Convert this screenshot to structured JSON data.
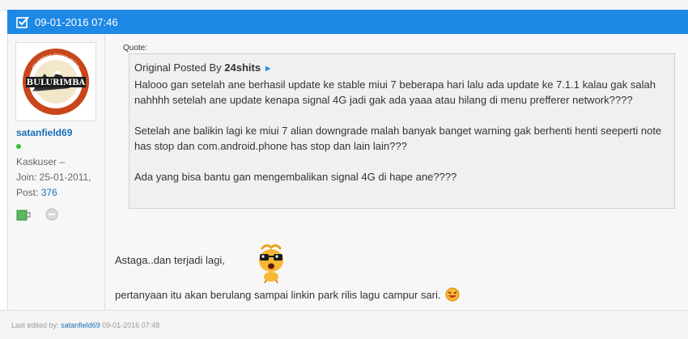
{
  "post": {
    "timestamp": "09-01-2016 07:46"
  },
  "user": {
    "username": "satanfield69",
    "rank": "Kaskuser –",
    "join_label": "Join: 25-01-2011,",
    "post_label": "Post:",
    "post_count": "376",
    "avatar_text": "BULURIMBA",
    "avatar_top_text": "KELOMPOK TEKNIK MESIN",
    "avatar_bottom_text": "SUKA DAMAI INDAH MESIN BIAS AJA"
  },
  "quote": {
    "label": "Quote:",
    "original_prefix": "Original Posted By",
    "original_poster": "24shits",
    "arrow": "►",
    "paragraphs": [
      "Halooo gan setelah ane berhasil update ke stable miui 7 beberapa hari lalu ada update ke 7.1.1 kalau gak salah nahhhh setelah ane update kenapa signal 4G jadi gak ada yaaa atau hilang di menu prefferer network????",
      "Setelah ane balikin lagi ke miui 7 alian downgrade malah banyak banget warning gak berhenti henti seeperti note has stop dan com.android.phone has stop dan lain lain???",
      "Ada yang bisa bantu gan mengembalikan signal 4G di hape ane????"
    ]
  },
  "message": {
    "line1": "Astaga..dan terjadi lagi,",
    "line2": "pertanyaan itu akan berulang sampai linkin park rilis lagu campur sari."
  },
  "footer": {
    "edited_prefix": "Last edited by:",
    "edited_user": "satanfield69",
    "edited_time": "09-01-2016 07:48"
  },
  "icons": {
    "header": "checkbox-icon",
    "user_icon_1": "reputation-icon",
    "user_icon_2": "offline-icon",
    "emoticon_big": "shocked-emoticon",
    "emoticon_small": "laughing-emoticon"
  },
  "colors": {
    "header_bg": "#1e88e5",
    "username": "#1a6fb5",
    "online": "#35c035"
  }
}
